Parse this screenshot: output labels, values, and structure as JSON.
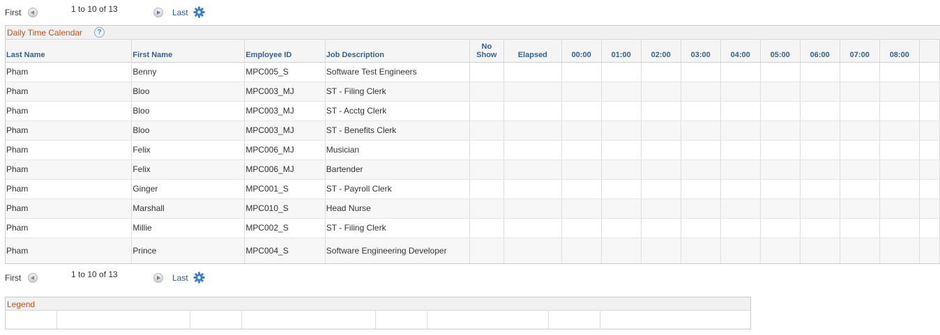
{
  "pager_top": {
    "first": "First",
    "range": "1 to 10 of 13",
    "last": "Last",
    "prev_icon": "prev-arrow-icon",
    "next_icon": "next-arrow-icon",
    "settings_icon": "gear-icon"
  },
  "pager_bottom": {
    "first": "First",
    "range": "1 to 10 of 13",
    "last": "Last"
  },
  "grid": {
    "title": "Daily Time Calendar",
    "help": "?",
    "columns": {
      "last_name": "Last Name",
      "first_name": "First Name",
      "employee_id": "Employee ID",
      "job_description": "Job Description",
      "no_show_1": "No",
      "no_show_2": "Show",
      "elapsed": "Elapsed",
      "hours": [
        "00:00",
        "01:00",
        "02:00",
        "03:00",
        "04:00",
        "05:00",
        "06:00",
        "07:00",
        "08:00"
      ]
    },
    "rows": [
      {
        "last": "Pham",
        "first": "Benny",
        "id": "MPC005_S",
        "job": "Software Test Engineers"
      },
      {
        "last": "Pham",
        "first": "Bloo",
        "id": "MPC003_MJ",
        "job": "ST - Filing Clerk"
      },
      {
        "last": "Pham",
        "first": "Bloo",
        "id": "MPC003_MJ",
        "job": "ST - Acctg Clerk"
      },
      {
        "last": "Pham",
        "first": "Bloo",
        "id": "MPC003_MJ",
        "job": "ST - Benefits Clerk"
      },
      {
        "last": "Pham",
        "first": "Felix",
        "id": "MPC006_MJ",
        "job": "Musician"
      },
      {
        "last": "Pham",
        "first": "Felix",
        "id": "MPC006_MJ",
        "job": "Bartender"
      },
      {
        "last": "Pham",
        "first": "Ginger",
        "id": "MPC001_S",
        "job": "ST - Payroll Clerk"
      },
      {
        "last": "Pham",
        "first": "Marshall",
        "id": "MPC010_S",
        "job": "Head Nurse"
      },
      {
        "last": "Pham",
        "first": "Millie",
        "id": "MPC002_S",
        "job": "ST - Filing Clerk"
      },
      {
        "last": "Pham",
        "first": "Prince",
        "id": "MPC004_S",
        "job": "Software Engineering Developer"
      }
    ]
  },
  "legend": {
    "title": "Legend"
  },
  "colors": {
    "section_title": "#c0531a",
    "header_text": "#34628f",
    "link": "#2a5a8a",
    "gear": "#3b82c4"
  }
}
